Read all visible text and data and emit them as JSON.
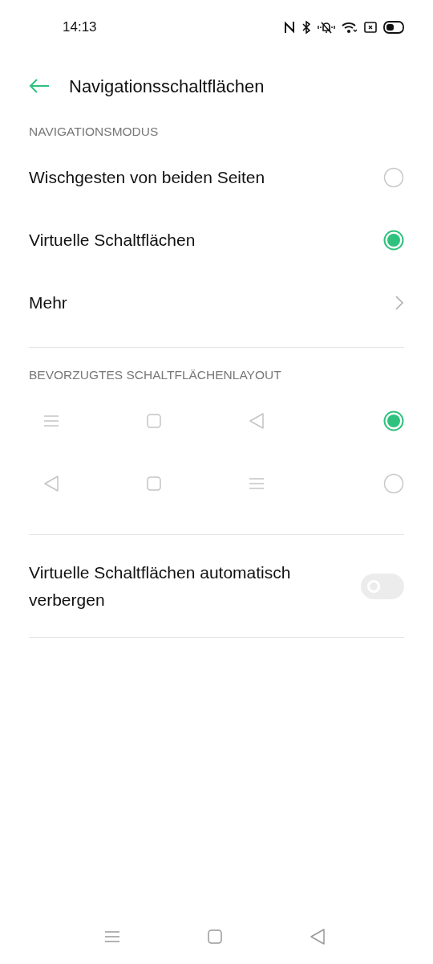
{
  "status_bar": {
    "time": "14:13"
  },
  "header": {
    "title": "Navigationsschaltflächen"
  },
  "navigation_mode": {
    "heading": "NAVIGATIONSMODUS",
    "items": [
      {
        "kind": "radio",
        "label": "Wischgesten von beiden Seiten",
        "selected": false
      },
      {
        "kind": "radio",
        "label": "Virtuelle Schaltflächen",
        "selected": true
      },
      {
        "kind": "link",
        "label": "Mehr"
      }
    ]
  },
  "button_layout": {
    "heading": "BEVORZUGTES SCHALTFLÄCHENLAYOUT",
    "options": [
      {
        "selected": true,
        "buttons": [
          {
            "kind": "menu"
          },
          {
            "kind": "home"
          },
          {
            "kind": "back"
          }
        ]
      },
      {
        "selected": false,
        "buttons": [
          {
            "kind": "back"
          },
          {
            "kind": "home"
          },
          {
            "kind": "menu"
          }
        ]
      }
    ]
  },
  "auto_hide": {
    "label": "Virtuelle Schaltflächen automatisch verbergen",
    "on": false
  },
  "nav_bar": {
    "buttons": [
      {
        "kind": "menu"
      },
      {
        "kind": "home"
      },
      {
        "kind": "back"
      }
    ]
  }
}
